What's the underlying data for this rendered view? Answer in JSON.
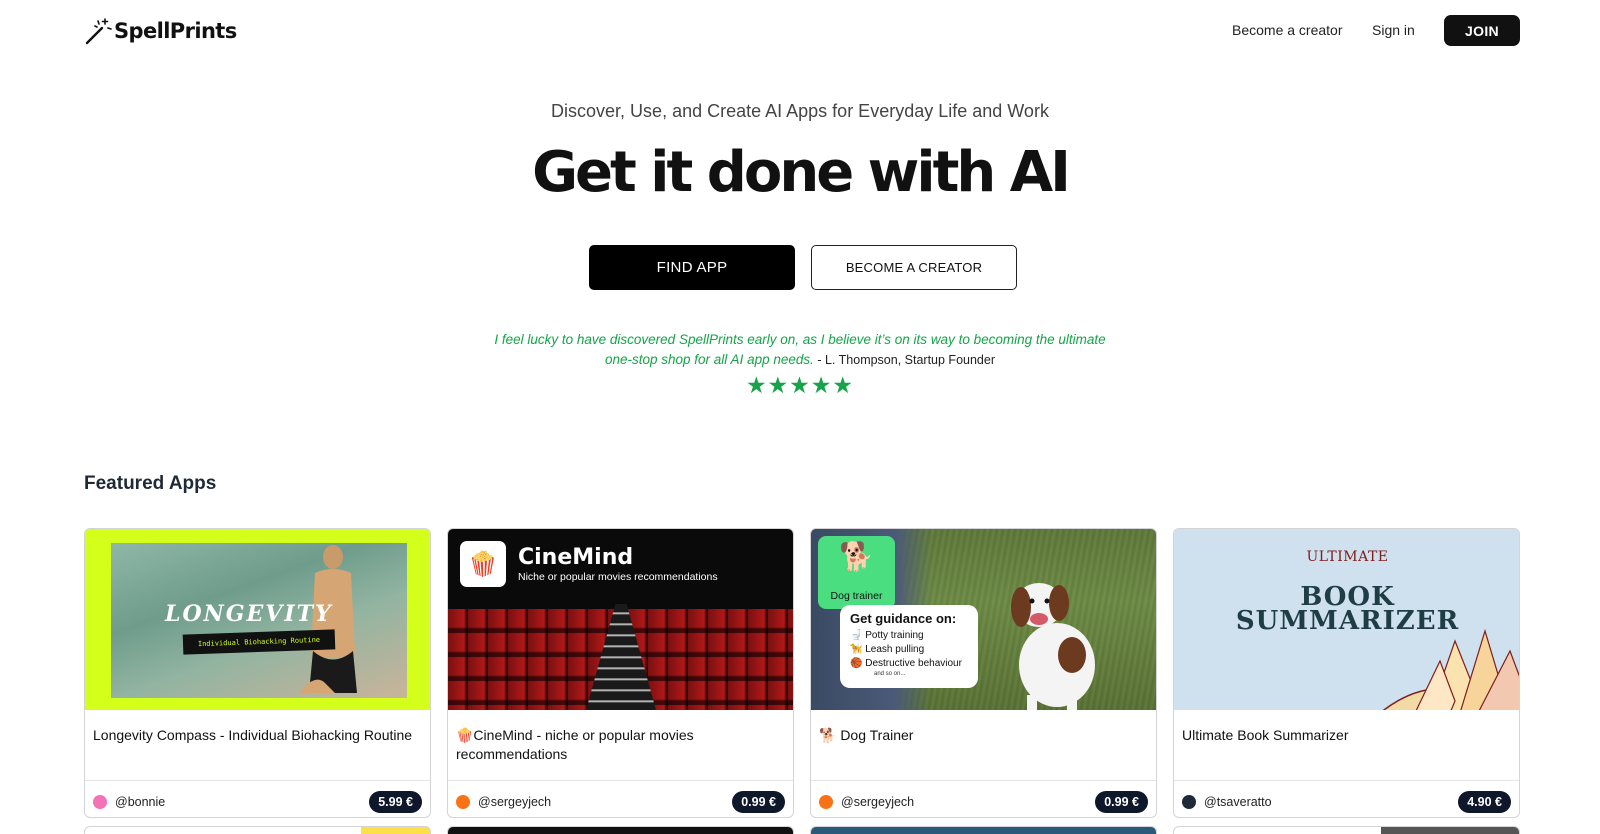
{
  "header": {
    "brand": "SpellPrints",
    "nav_become_creator": "Become a creator",
    "nav_sign_in": "Sign in",
    "join_label": "JOIN"
  },
  "hero": {
    "subtitle": "Discover, Use, and Create AI Apps for Everyday Life and Work",
    "title": "Get it done with AI",
    "find_app_label": "FIND APP",
    "become_creator_label": "BECOME A CREATOR",
    "quote_text": "I feel lucky to have discovered SpellPrints early on, as I believe it’s on its way to becoming the ultimate one-stop shop for all AI app needs.",
    "quote_author": " - L. Thompson, Startup Founder",
    "rating": 5,
    "stars": "★★★★★"
  },
  "featured": {
    "title": "Featured Apps",
    "cards": [
      {
        "title": "Longevity Compass - Individual Biohacking Routine",
        "author": "@bonnie",
        "price": "5.99 €",
        "avatar_color": "#f472b6",
        "thumb": {
          "word": "LONGEVITY",
          "tag": "Individual Biohacking Routine"
        }
      },
      {
        "title": "🍿CineMind - niche or popular movies recommendations",
        "author": "@sergeyjech",
        "price": "0.99 €",
        "avatar_color": "#f97316",
        "thumb": {
          "icon": "🍿",
          "name": "CineMind",
          "sub": "Niche or popular movies recommendations"
        }
      },
      {
        "title": "🐕 Dog Trainer",
        "author": "@sergeyjech",
        "price": "0.99 €",
        "avatar_color": "#f97316",
        "thumb": {
          "icon": "🐕",
          "icon_label": "Dog trainer",
          "guide_title": "Get guidance on:",
          "items": [
            "🚽 Potty training",
            "🦮 Leash pulling",
            "🏀 Destructive behaviour"
          ],
          "more": "and so on..."
        }
      },
      {
        "title": "Ultimate Book Summarizer",
        "author": "@tsaveratto",
        "price": "4.90 €",
        "avatar_color": "#1f2937",
        "thumb": {
          "top": "ULTIMATE",
          "line1": "BOOK",
          "line2": "SUMMARIZER"
        }
      }
    ]
  },
  "colors": {
    "accent_green": "#16a34a",
    "button_black": "#000000",
    "price_badge": "#0f172a",
    "lime": "#d4ff1a"
  }
}
